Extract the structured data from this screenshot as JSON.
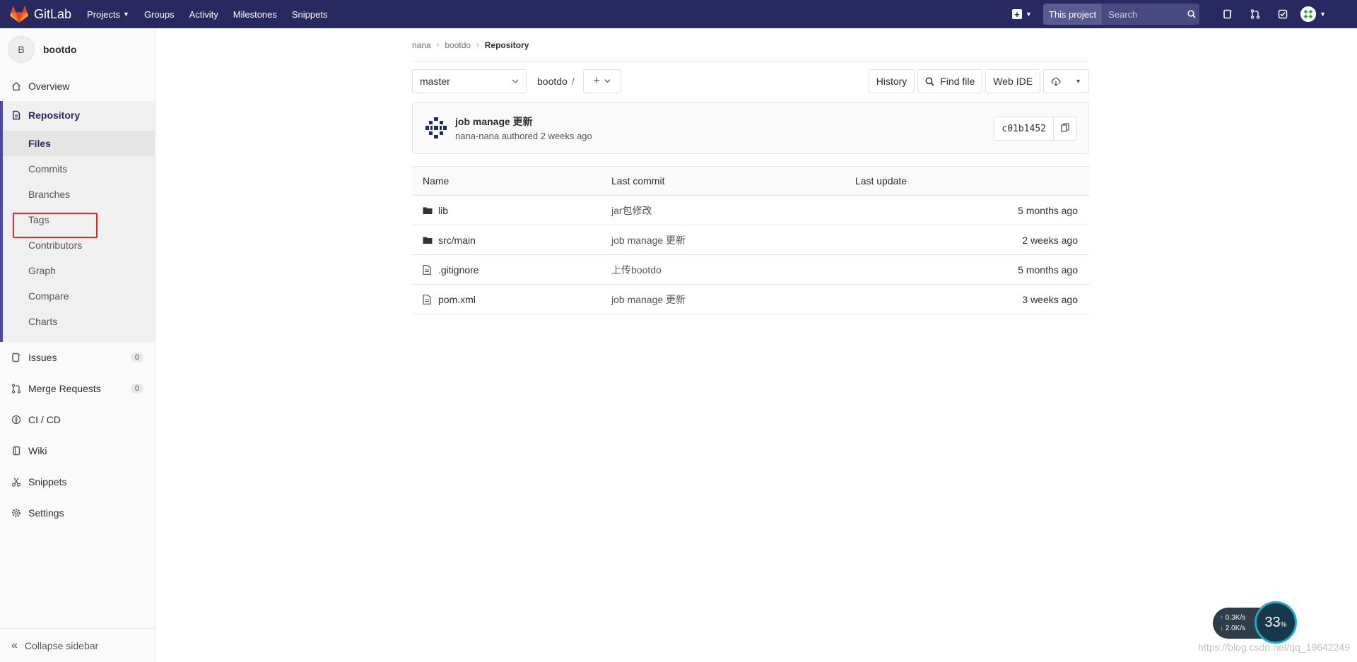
{
  "navbar": {
    "logo_text": "GitLab",
    "links": [
      {
        "label": "Projects",
        "has_caret": true
      },
      {
        "label": "Groups"
      },
      {
        "label": "Activity"
      },
      {
        "label": "Milestones"
      },
      {
        "label": "Snippets"
      }
    ],
    "search_scope": "This project",
    "search_placeholder": "Search",
    "brand_color": "#292961"
  },
  "sidebar": {
    "project_initial": "B",
    "project_name": "bootdo",
    "overview": "Overview",
    "repository": "Repository",
    "repo_items": [
      "Files",
      "Commits",
      "Branches",
      "Tags",
      "Contributors",
      "Graph",
      "Compare",
      "Charts"
    ],
    "active_repo_item": "Files",
    "issues": {
      "label": "Issues",
      "count": "0"
    },
    "merge_requests": {
      "label": "Merge Requests",
      "count": "0"
    },
    "ci_cd": "CI / CD",
    "wiki": "Wiki",
    "snippets": "Snippets",
    "settings": "Settings",
    "collapse": "Collapse sidebar"
  },
  "breadcrumb": [
    "nana",
    "bootdo",
    "Repository"
  ],
  "toolbar": {
    "branch": "master",
    "path": "bootdo",
    "path_sep": "/",
    "history": "History",
    "find_file": "Find file",
    "web_ide": "Web IDE"
  },
  "commit": {
    "title": "job manage 更新",
    "author": "nana-nana",
    "authored": "authored",
    "time": "2 weeks ago",
    "sha": "c01b1452"
  },
  "table": {
    "headers": {
      "name": "Name",
      "last_commit": "Last commit",
      "last_update": "Last update"
    },
    "rows": [
      {
        "type": "folder",
        "name": "lib",
        "commit": "jar包修改",
        "updated": "5 months ago"
      },
      {
        "type": "folder",
        "name": "src/main",
        "commit": "job manage 更新",
        "updated": "2 weeks ago"
      },
      {
        "type": "file",
        "name": ".gitignore",
        "commit": "上传bootdo",
        "updated": "5 months ago"
      },
      {
        "type": "file",
        "name": "pom.xml",
        "commit": "job manage 更新",
        "updated": "3 weeks ago"
      }
    ]
  },
  "network_widget": {
    "up": "0.3",
    "down": "2.0",
    "unit": "K/s",
    "percent": "33",
    "percent_sign": "%"
  },
  "watermark": "https://blog.csdn.net/qq_19642249"
}
